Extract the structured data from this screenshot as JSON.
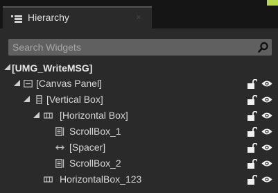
{
  "tab": {
    "title": "Hierarchy",
    "close": "×"
  },
  "search": {
    "placeholder": "Search Widgets"
  },
  "tree": {
    "root": "[UMG_WriteMSG]",
    "items": [
      {
        "label": "[Canvas Panel]",
        "icon": "canvas-panel-icon"
      },
      {
        "label": "[Vertical Box]",
        "icon": "vertical-box-icon"
      },
      {
        "label": "[Horizontal Box]",
        "icon": "horizontal-box-icon"
      },
      {
        "label": "ScrollBox_1",
        "icon": "scrollbox-icon"
      },
      {
        "label": "[Spacer]",
        "icon": "spacer-icon"
      },
      {
        "label": "ScrollBox_2",
        "icon": "scrollbox-icon"
      },
      {
        "label": "HorizontalBox_123",
        "icon": "horizontal-box-icon"
      }
    ]
  },
  "colors": {
    "accent": "#b7d84a",
    "background": "#2a2a2a",
    "tabbar": "#151515",
    "search": "#606060"
  }
}
